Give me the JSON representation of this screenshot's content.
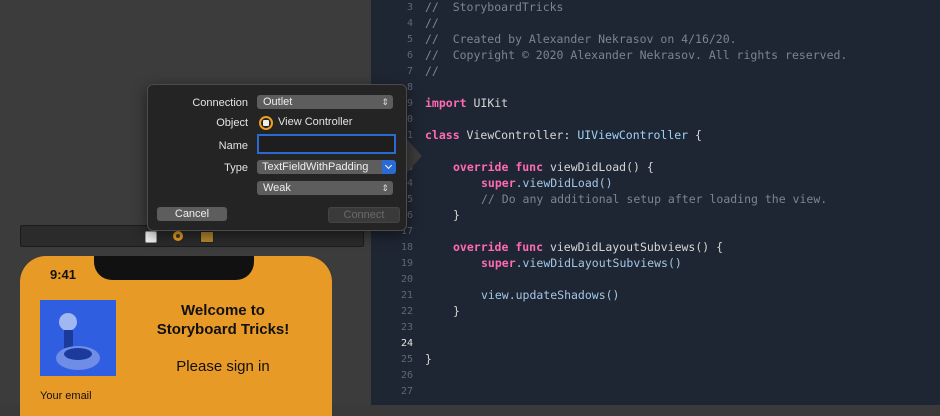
{
  "canvas": {
    "phone": {
      "time": "9:41",
      "welcome_line1": "Welcome to",
      "welcome_line2": "Storyboard Tricks!",
      "signin": "Please sign in",
      "email_label": "Your email"
    }
  },
  "editor": {
    "line_numbers": [
      "3",
      "4",
      "5",
      "6",
      "7",
      "8",
      "9",
      "10",
      "11",
      "12",
      "13",
      "14",
      "15",
      "16",
      "17",
      "18",
      "19",
      "20",
      "21",
      "22",
      "23",
      "24",
      "25",
      "26",
      "27"
    ],
    "current_line": "24",
    "lines": {
      "l3": "//  StoryboardTricks",
      "l4": "//",
      "l5": "//  Created by Alexander Nekrasov on 4/16/20.",
      "l6": "//  Copyright © 2020 Alexander Nekrasov. All rights reserved.",
      "l7": "//",
      "l9_kw": "import",
      "l9_rest": " UIKit",
      "l11_kw": "class",
      "l11_name": " ViewController: ",
      "l11_type": "UIViewController",
      "l11_end": " {",
      "l13_kw1": "override",
      "l13_kw2": " func",
      "l13_rest": " viewDidLoad() {",
      "l14_kw": "super",
      "l14_rest": ".viewDidLoad()",
      "l15": "// Do any additional setup after loading the view.",
      "l16": "}",
      "l18_kw1": "override",
      "l18_kw2": " func",
      "l18_rest": " viewDidLayoutSubviews() {",
      "l19_kw": "super",
      "l19_rest": ".viewDidLayoutSubviews()",
      "l21": "view.updateShadows()",
      "l22": "}",
      "l26": "}"
    }
  },
  "popover": {
    "connection_label": "Connection",
    "connection_value": "Outlet",
    "object_label": "Object",
    "object_value": "View Controller",
    "name_label": "Name",
    "name_value": "",
    "type_label": "Type",
    "type_value": "TextFieldWithPadding",
    "storage_value": "Weak",
    "cancel": "Cancel",
    "connect": "Connect"
  }
}
